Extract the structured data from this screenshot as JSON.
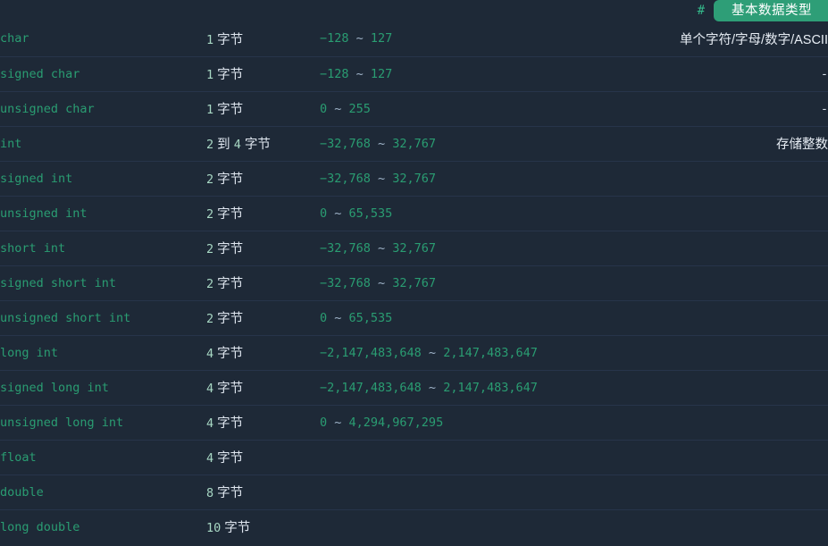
{
  "header": {
    "anchor_symbol": "#",
    "section_title": "基本数据类型",
    "badge_color": "#2e9e77",
    "accent_color": "#34b88a",
    "background_color": "#1e2937"
  },
  "table": {
    "unit_label": "字节",
    "range_separator": "~",
    "empty_value": "-",
    "rows": [
      {
        "type": "char",
        "size_number": "1",
        "size_text": "1 字节",
        "range": "−128 ~ 127",
        "range_low": "−128",
        "range_high": "127",
        "description": "单个字符/字母/数字/ASCII"
      },
      {
        "type": "signed char",
        "size_number": "1",
        "size_text": "1 字节",
        "range": "−128 ~ 127",
        "range_low": "−128",
        "range_high": "127",
        "description": "-"
      },
      {
        "type": "unsigned char",
        "size_number": "1",
        "size_text": "1 字节",
        "range": "0 ~ 255",
        "range_low": "0",
        "range_high": "255",
        "description": "-"
      },
      {
        "type": "int",
        "size_number": "2 到 4",
        "size_text": "2 到 4 字节",
        "range": "−32,768 ~ 32,767",
        "range_low": "−32,768",
        "range_high": "32,767",
        "description": "存储整数"
      },
      {
        "type": "signed int",
        "size_number": "2",
        "size_text": "2 字节",
        "range": "−32,768 ~ 32,767",
        "range_low": "−32,768",
        "range_high": "32,767",
        "description": ""
      },
      {
        "type": "unsigned int",
        "size_number": "2",
        "size_text": "2 字节",
        "range": "0 ~ 65,535",
        "range_low": "0",
        "range_high": "65,535",
        "description": ""
      },
      {
        "type": "short int",
        "size_number": "2",
        "size_text": "2 字节",
        "range": "−32,768 ~ 32,767",
        "range_low": "−32,768",
        "range_high": "32,767",
        "description": ""
      },
      {
        "type": "signed short int",
        "size_number": "2",
        "size_text": "2 字节",
        "range": "−32,768 ~ 32,767",
        "range_low": "−32,768",
        "range_high": "32,767",
        "description": ""
      },
      {
        "type": "unsigned short int",
        "size_number": "2",
        "size_text": "2 字节",
        "range": "0 ~ 65,535",
        "range_low": "0",
        "range_high": "65,535",
        "description": ""
      },
      {
        "type": "long int",
        "size_number": "4",
        "size_text": "4 字节",
        "range": "−2,147,483,648 ~ 2,147,483,647",
        "range_low": "−2,147,483,648",
        "range_high": "2,147,483,647",
        "description": ""
      },
      {
        "type": "signed long int",
        "size_number": "4",
        "size_text": "4 字节",
        "range": "−2,147,483,648 ~ 2,147,483,647",
        "range_low": "−2,147,483,648",
        "range_high": "2,147,483,647",
        "description": ""
      },
      {
        "type": "unsigned long int",
        "size_number": "4",
        "size_text": "4 字节",
        "range": "0 ~ 4,294,967,295",
        "range_low": "0",
        "range_high": "4,294,967,295",
        "description": ""
      },
      {
        "type": "float",
        "size_number": "4",
        "size_text": "4 字节",
        "range": "",
        "range_low": "",
        "range_high": "",
        "description": ""
      },
      {
        "type": "double",
        "size_number": "8",
        "size_text": "8 字节",
        "range": "",
        "range_low": "",
        "range_high": "",
        "description": ""
      },
      {
        "type": "long double",
        "size_number": "10",
        "size_text": "10 字节",
        "range": "",
        "range_low": "",
        "range_high": "",
        "description": ""
      }
    ]
  }
}
